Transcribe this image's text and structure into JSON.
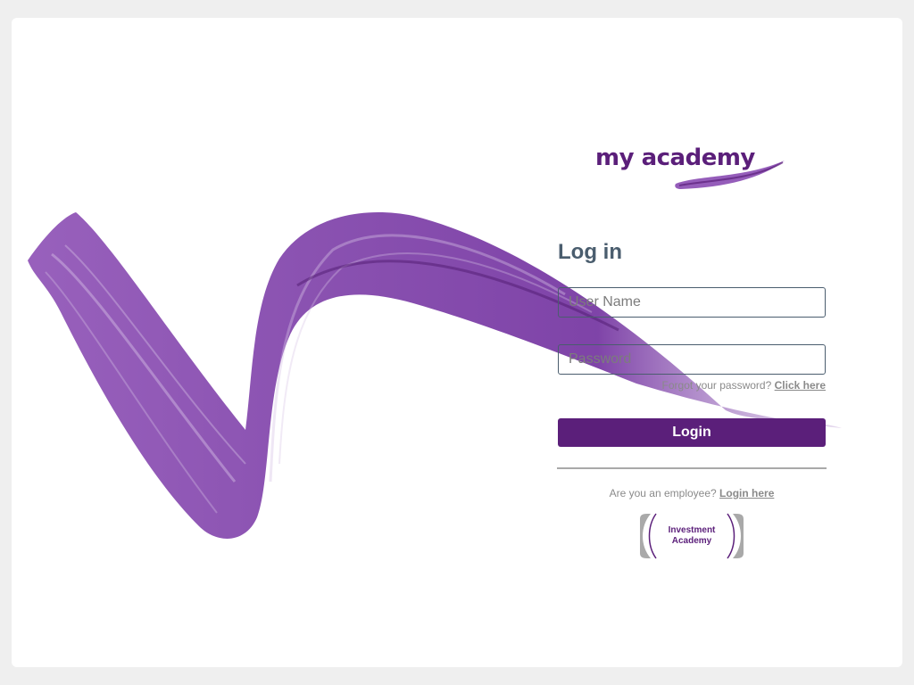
{
  "brand": {
    "logo_text": "my academy",
    "accent_color": "#5b1f7a"
  },
  "login": {
    "title": "Log in",
    "username_placeholder": "User Name",
    "password_placeholder": "Password",
    "forgot_text": "Forgot your password?",
    "forgot_link": "Click here",
    "login_button": "Login",
    "employee_text": "Are you an employee?",
    "employee_link": "Login here"
  },
  "partner_logo": {
    "line1": "Investment",
    "line2": "Academy"
  }
}
